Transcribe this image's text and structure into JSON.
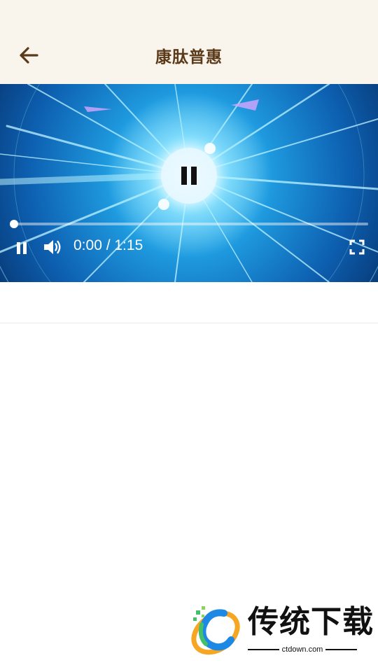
{
  "header": {
    "title": "康肽普惠",
    "back_icon": "arrow-left-icon",
    "background": "#f9f4ec",
    "title_color": "#5b3a1a"
  },
  "video": {
    "current_time": "0:00",
    "separator": "/",
    "duration": "1:15",
    "time_display": "0:00 / 1:15",
    "progress_fraction": 0,
    "state": "playing",
    "controls": {
      "center_icon": "pause-icon",
      "pause_icon": "pause-icon",
      "volume_icon": "volume-icon",
      "fullscreen_icon": "fullscreen-icon"
    }
  },
  "watermark": {
    "brand_text": "传统下载",
    "site_text": "ctdown.com"
  }
}
